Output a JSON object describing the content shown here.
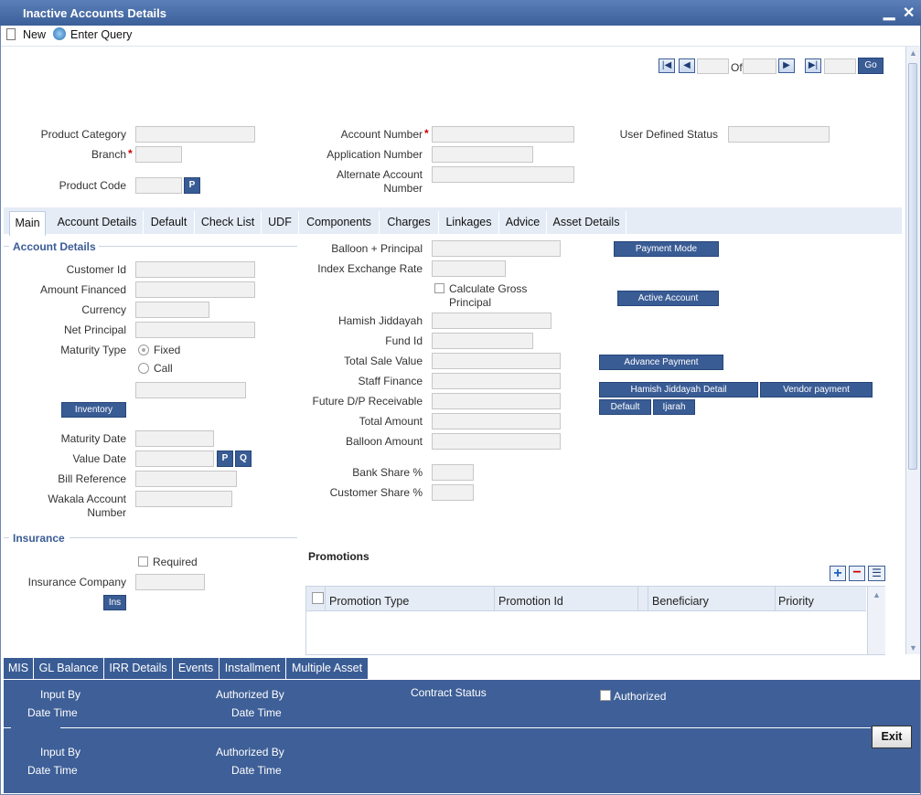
{
  "window": {
    "title": "Inactive Accounts Details",
    "minimize": "▁",
    "close": "✕"
  },
  "toolbar": {
    "new_label": "New",
    "enter_query_label": "Enter Query"
  },
  "pager": {
    "of_label": "Of",
    "go_label": "Go"
  },
  "header": {
    "product_category_label": "Product Category",
    "branch_label": "Branch",
    "product_code_label": "Product Code",
    "product_code_btn": "P",
    "account_number_label": "Account Number",
    "application_number_label": "Application Number",
    "alternate_account_label_1": "Alternate Account",
    "alternate_account_label_2": "Number",
    "user_defined_status_label": "User Defined Status",
    "required_marker": "*"
  },
  "tabs": [
    "Main",
    "Account Details",
    "Default",
    "Check List",
    "UDF",
    "Components",
    "Charges",
    "Linkages",
    "Advice",
    "Asset Details"
  ],
  "account_details": {
    "section_title": "Account Details",
    "customer_id_label": "Customer Id",
    "amount_financed_label": "Amount Financed",
    "currency_label": "Currency",
    "net_principal_label": "Net Principal",
    "maturity_type_label": "Maturity Type",
    "fixed_label": "Fixed",
    "call_label": "Call",
    "inventory_btn": "Inventory",
    "maturity_date_label": "Maturity Date",
    "value_date_label": "Value Date",
    "value_date_p": "P",
    "value_date_q": "Q",
    "bill_reference_label": "Bill Reference",
    "wakala_label_1": "Wakala Account",
    "wakala_label_2": "Number"
  },
  "middle": {
    "balloon_principal_label": "Balloon + Principal",
    "index_exchange_rate_label": "Index Exchange Rate",
    "calc_gross_label_1": "Calculate Gross",
    "calc_gross_label_2": "Principal",
    "hamish_jiddayah_label": "Hamish Jiddayah",
    "fund_id_label": "Fund Id",
    "total_sale_value_label": "Total Sale Value",
    "staff_finance_label": "Staff Finance",
    "future_dp_label": "Future D/P Receivable",
    "total_amount_label": "Total Amount",
    "balloon_amount_label": "Balloon Amount",
    "bank_share_label": "Bank Share %",
    "customer_share_label": "Customer Share %"
  },
  "right_buttons": {
    "payment_mode": "Payment Mode",
    "active_account": "Active Account",
    "advance_payment": "Advance Payment",
    "hamish_detail": "Hamish Jiddayah Detail",
    "vendor_payment": "Vendor payment",
    "default": "Default",
    "ijarah": "Ijarah"
  },
  "insurance": {
    "section_title": "Insurance",
    "required_label": "Required",
    "company_label": "Insurance Company",
    "ins_btn": "Ins"
  },
  "promotions": {
    "title": "Promotions",
    "columns": [
      "Promotion Type",
      "Promotion Id",
      "Beneficiary",
      "Priority"
    ]
  },
  "bottom_tabs": [
    "MIS",
    "GL Balance",
    "IRR Details",
    "Events",
    "Installment",
    "Multiple Asset"
  ],
  "footer": {
    "input_by": "Input By",
    "date_time": "Date Time",
    "authorized_by": "Authorized By",
    "contract_status": "Contract Status",
    "authorized": "Authorized",
    "exit": "Exit"
  },
  "colors": {
    "accent": "#3a5c95",
    "title_bar": "#4a6ea8",
    "required": "#cc0000"
  }
}
